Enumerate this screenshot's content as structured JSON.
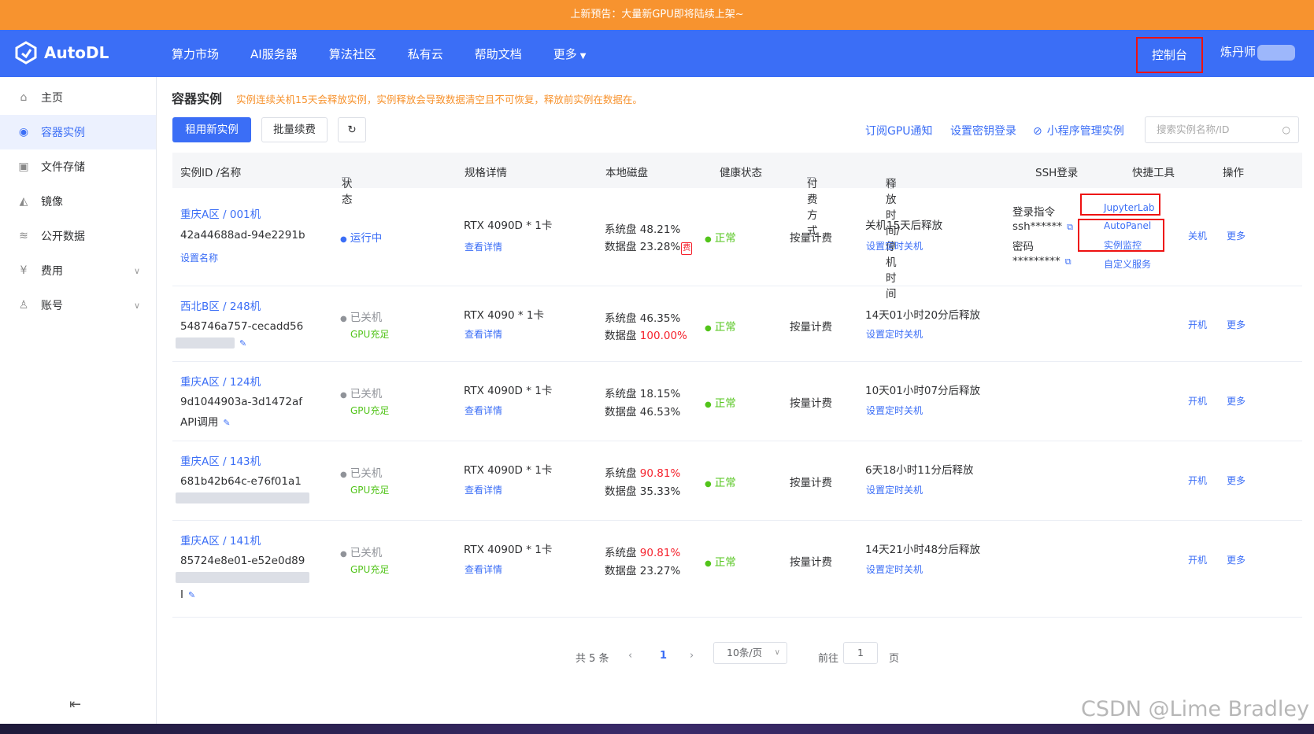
{
  "banner": "上新预告：大量新GPU即将陆续上架~",
  "brand": "AutoDL",
  "nav": [
    "算力市场",
    "AI服务器",
    "算法社区",
    "私有云",
    "帮助文档",
    "更多"
  ],
  "console": "控制台",
  "user": "炼丹师",
  "sidebar": [
    {
      "label": "主页",
      "icon": "home-icon"
    },
    {
      "label": "容器实例",
      "icon": "container-icon"
    },
    {
      "label": "文件存储",
      "icon": "storage-icon"
    },
    {
      "label": "镜像",
      "icon": "image-icon"
    },
    {
      "label": "公开数据",
      "icon": "database-icon"
    },
    {
      "label": "费用",
      "icon": "yen-icon"
    },
    {
      "label": "账号",
      "icon": "user-icon"
    }
  ],
  "page": {
    "title": "容器实例",
    "warning": "实例连续关机15天会释放实例，实例释放会导致数据清空且不可恢复，释放前实例在数据在。",
    "rent_btn": "租用新实例",
    "renew_btn": "批量续费",
    "links": [
      "订阅GPU通知",
      "设置密钥登录",
      "小程序管理实例"
    ],
    "search_placeholder": "搜索实例名称/ID"
  },
  "columns": [
    "实例ID /名称",
    "状态",
    "规格详情",
    "本地磁盘",
    "健康状态",
    "付费方式",
    "释放时间/停机时间",
    "SSH登录",
    "快捷工具",
    "操作"
  ],
  "rows": [
    {
      "region": "重庆A区 / 001机",
      "id": "42a44688ad-94e2291b",
      "name": "设置名称",
      "status": "运行中",
      "status_sub": "",
      "gpu": "RTX 4090D * 1卡",
      "detail": "查看详情",
      "sys_disk_label": "系统盘",
      "sys_disk": "48.21%",
      "data_disk_label": "数据盘",
      "data_disk": "23.28%",
      "fee_tag": "费",
      "health": "正常",
      "pay": "按量计费",
      "release": "关机15天后释放",
      "timer": "设置定时关机",
      "ssh_cmd": "登录指令",
      "ssh_val": "ssh******",
      "pwd_label": "密码",
      "pwd_val": "*********",
      "tools": [
        "JupyterLab",
        "AutoPanel",
        "实例监控",
        "自定义服务"
      ],
      "ops": [
        "关机",
        "更多"
      ]
    },
    {
      "region": "西北B区 / 248机",
      "id": "548746a757-cecadd56",
      "name": "",
      "status": "已关机",
      "status_sub": "GPU充足",
      "gpu": "RTX 4090 * 1卡",
      "detail": "查看详情",
      "sys_disk_label": "系统盘",
      "sys_disk": "46.35%",
      "data_disk_label": "数据盘",
      "data_disk": "100.00%",
      "health": "正常",
      "pay": "按量计费",
      "release": "14天01小时20分后释放",
      "timer": "设置定时关机",
      "ops": [
        "开机",
        "更多"
      ]
    },
    {
      "region": "重庆A区 / 124机",
      "id": "9d1044903a-3d1472af",
      "name": "API调用",
      "status": "已关机",
      "status_sub": "GPU充足",
      "gpu": "RTX 4090D * 1卡",
      "detail": "查看详情",
      "sys_disk_label": "系统盘",
      "sys_disk": "18.15%",
      "data_disk_label": "数据盘",
      "data_disk": "46.53%",
      "health": "正常",
      "pay": "按量计费",
      "release": "10天01小时07分后释放",
      "timer": "设置定时关机",
      "ops": [
        "开机",
        "更多"
      ]
    },
    {
      "region": "重庆A区 / 143机",
      "id": "681b42b64c-e76f01a1",
      "name": "",
      "status": "已关机",
      "status_sub": "GPU充足",
      "gpu": "RTX 4090D * 1卡",
      "detail": "查看详情",
      "sys_disk_label": "系统盘",
      "sys_disk": "90.81%",
      "data_disk_label": "数据盘",
      "data_disk": "35.33%",
      "health": "正常",
      "pay": "按量计费",
      "release": "6天18小时11分后释放",
      "timer": "设置定时关机",
      "ops": [
        "开机",
        "更多"
      ]
    },
    {
      "region": "重庆A区 / 141机",
      "id": "85724e8e01-e52e0d89",
      "name": "I",
      "status": "已关机",
      "status_sub": "GPU充足",
      "gpu": "RTX 4090D * 1卡",
      "detail": "查看详情",
      "sys_disk_label": "系统盘",
      "sys_disk": "90.81%",
      "data_disk_label": "数据盘",
      "data_disk": "23.27%",
      "health": "正常",
      "pay": "按量计费",
      "release": "14天21小时48分后释放",
      "timer": "设置定时关机",
      "ops": [
        "开机",
        "更多"
      ]
    }
  ],
  "pagination": {
    "total": "共 5 条",
    "current": "1",
    "page_size": "10条/页",
    "goto": "前往",
    "goto_val": "1",
    "page_unit": "页"
  },
  "watermark": "CSDN @Lime Bradley"
}
